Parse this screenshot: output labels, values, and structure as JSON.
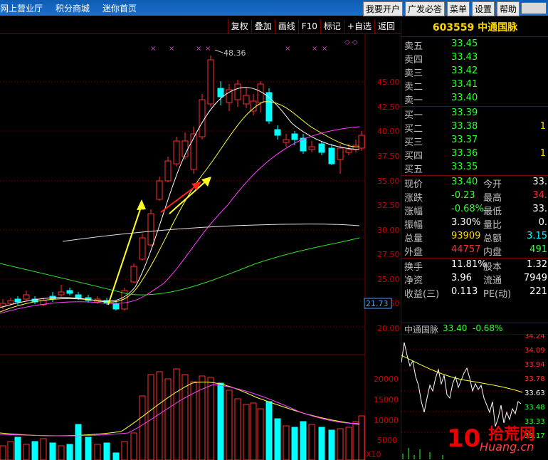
{
  "menu": {
    "nav": [
      "网上营业厅",
      "积分商城",
      "迷你首页"
    ],
    "buttons": [
      "我要开户",
      "广发必答",
      "菜单",
      "设置",
      "帮助"
    ]
  },
  "toolbar": [
    "复权",
    "叠加",
    "画线",
    "F10",
    "标记",
    "+自选",
    "返回"
  ],
  "chart": {
    "peak_label": "48.36",
    "price_label": "21.73",
    "price_ticks": [
      "45.00",
      "42.50",
      "40.00",
      "37.50",
      "35.00",
      "32.50",
      "30.00",
      "27.50",
      "25.00",
      "22.50",
      "20.00"
    ],
    "volume_ticks": [
      "20000",
      "15000",
      "10000",
      "5000"
    ],
    "volume_unit": "X10",
    "markers": [
      "×",
      "×",
      "×",
      "×",
      "×",
      "×",
      "×",
      "×"
    ]
  },
  "quote": {
    "code_name": "603559 中通国脉",
    "sell": [
      {
        "label": "卖五",
        "price": "33.45",
        "vol": ""
      },
      {
        "label": "卖四",
        "price": "33.43",
        "vol": ""
      },
      {
        "label": "卖三",
        "price": "33.42",
        "vol": ""
      },
      {
        "label": "卖二",
        "price": "33.41",
        "vol": ""
      },
      {
        "label": "卖一",
        "price": "33.40",
        "vol": ""
      }
    ],
    "buy": [
      {
        "label": "买一",
        "price": "33.39",
        "vol": ""
      },
      {
        "label": "买二",
        "price": "33.38",
        "vol": "1"
      },
      {
        "label": "买三",
        "price": "33.37",
        "vol": ""
      },
      {
        "label": "买四",
        "price": "33.36",
        "vol": "1"
      },
      {
        "label": "买五",
        "price": "33.35",
        "vol": ""
      }
    ],
    "stats": [
      {
        "l1": "现价",
        "v1": "33.40",
        "l2": "今开",
        "v2": "33."
      },
      {
        "l1": "涨跌",
        "v1": "-0.23",
        "l2": "最高",
        "v2": "34."
      },
      {
        "l1": "涨幅",
        "v1": "-0.68%",
        "l2": "最低",
        "v2": "33."
      },
      {
        "l1": "振幅",
        "v1": "3.30%",
        "l2": "量比",
        "v2": "0."
      },
      {
        "l1": "总量",
        "v1": "93909",
        "l2": "总额",
        "v2": "3.15"
      },
      {
        "l1": "外盘",
        "v1": "44757",
        "l2": "内盘",
        "v2": "491"
      }
    ],
    "stats2": [
      {
        "l1": "换手",
        "v1": "11.81%",
        "l2": "股本",
        "v2": "1.32"
      },
      {
        "l1": "净资",
        "v1": "3.96",
        "l2": "流通",
        "v2": "7949"
      },
      {
        "l1": "收益(三)",
        "v1": "0.113",
        "l2": "PE(动)",
        "v2": "221"
      }
    ],
    "mini": {
      "name": "中通国脉",
      "price": "33.40",
      "change": "-0.68%",
      "ticks": [
        "34.24",
        "34.09",
        "33.94",
        "33.78",
        "33.63",
        "33.48",
        "33.33",
        "33.17"
      ]
    }
  },
  "watermark": {
    "badge": "10",
    "line1": "拾荒网",
    "line2": "Huang.cn"
  }
}
